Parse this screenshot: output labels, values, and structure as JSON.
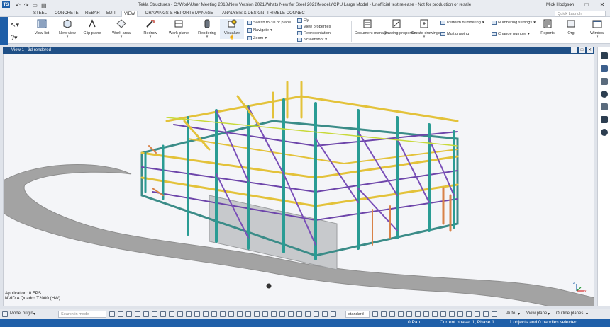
{
  "window": {
    "title": "Tekla Structures - C:\\Work\\User Meeting 2018\\New Version 2021\\Whats New for Steel 2021\\Models\\CPU Large Model - Unofficial test release - Not for production or resale",
    "user": "Mick Hodgson",
    "search_placeholder": "Quick Launch"
  },
  "tabs": [
    "STEEL",
    "CONCRETE",
    "REBAR",
    "EDIT",
    "VIEW",
    "DRAWINGS & REPORTS",
    "MANAGE",
    "ANALYSIS & DESIGN",
    "TRIMBLE CONNECT"
  ],
  "active_tab": "VIEW",
  "ribbon": {
    "buttons": [
      "View list",
      "New view",
      "Clip plane",
      "Work area",
      "Redraw",
      "Work plane",
      "Rendering",
      "Visualize"
    ],
    "small_left": [
      "Switch to 3D or plane",
      "Navigate",
      "Zoom"
    ],
    "small_right": [
      "Fly",
      "View properties",
      "Representation",
      "Screenshot"
    ],
    "buttons2": [
      "Document manager",
      "Drawing properties",
      "Create drawings"
    ],
    "small_draw": [
      "Perform numbering",
      "Multidrawing"
    ],
    "small_num": [
      "Numbering settings",
      "Change number"
    ],
    "reports": "Reports",
    "org": "Org",
    "window": "Window"
  },
  "view": {
    "title": "View 1 - 3d-rendered",
    "app_fps": "Application: 0 FPS",
    "gpu": "NVIDIA Quadro T2000 (HW)"
  },
  "status": {
    "model_origin": "Model origin",
    "search_placeholder": "Search in model",
    "standard": "standard",
    "auto": "Auto",
    "view_plane": "View plane",
    "outline_planes": "Outline planes"
  },
  "info": {
    "pan": "0 Pan",
    "phase": "Current phase: 1, Phase 1",
    "selection": "1 objects and 0 handles selected"
  },
  "colors": {
    "brand": "#1f5fa8",
    "teal_column": "#2a9c94",
    "yellow_beam": "#e3c23a",
    "purple_brace": "#7a4fb8",
    "orange_member": "#d98248",
    "ground_path": "#a3a3a3"
  }
}
